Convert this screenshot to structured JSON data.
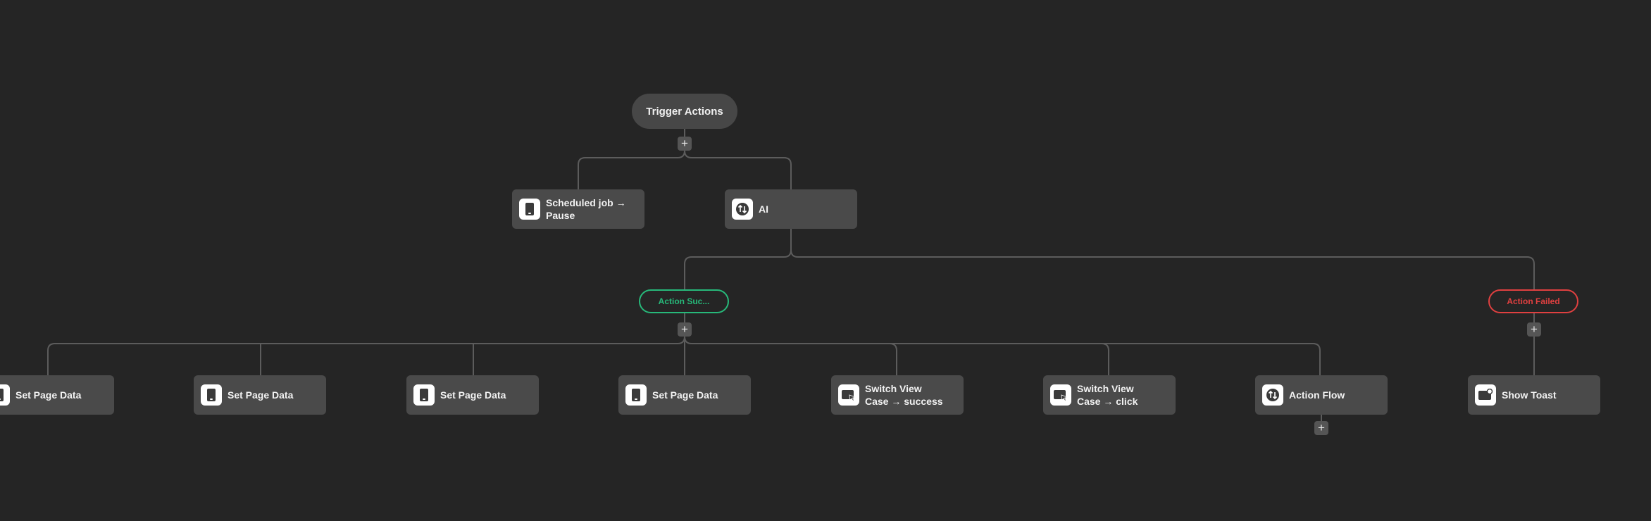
{
  "diagram": {
    "trigger": {
      "label": "Trigger Actions"
    },
    "level1": [
      {
        "id": "scheduled-job",
        "label": "Scheduled job → Pause",
        "icon": "phone-icon"
      },
      {
        "id": "ai",
        "label": "AI",
        "icon": "sort-arrows-icon"
      }
    ],
    "branches": {
      "success": {
        "label": "Action Suc..."
      },
      "failed": {
        "label": "Action Failed"
      }
    },
    "success_actions": [
      {
        "label": "Set Page Data",
        "icon": "phone-icon"
      },
      {
        "label": "Set Page Data",
        "icon": "phone-icon"
      },
      {
        "label": "Set Page Data",
        "icon": "phone-icon"
      },
      {
        "label": "Set Page Data",
        "icon": "phone-icon"
      },
      {
        "label": "Switch View Case → success",
        "icon": "switch-view-icon"
      },
      {
        "label": "Switch View Case → click",
        "icon": "switch-view-icon"
      },
      {
        "label": "Action Flow",
        "icon": "sort-arrows-icon"
      }
    ],
    "failed_actions": [
      {
        "label": "Show Toast",
        "icon": "toast-icon"
      }
    ],
    "colors": {
      "background": "#252525",
      "node": "#4a4a4a",
      "success": "#27b97a",
      "failed": "#e04040",
      "edge": "#5c5c5c"
    }
  }
}
